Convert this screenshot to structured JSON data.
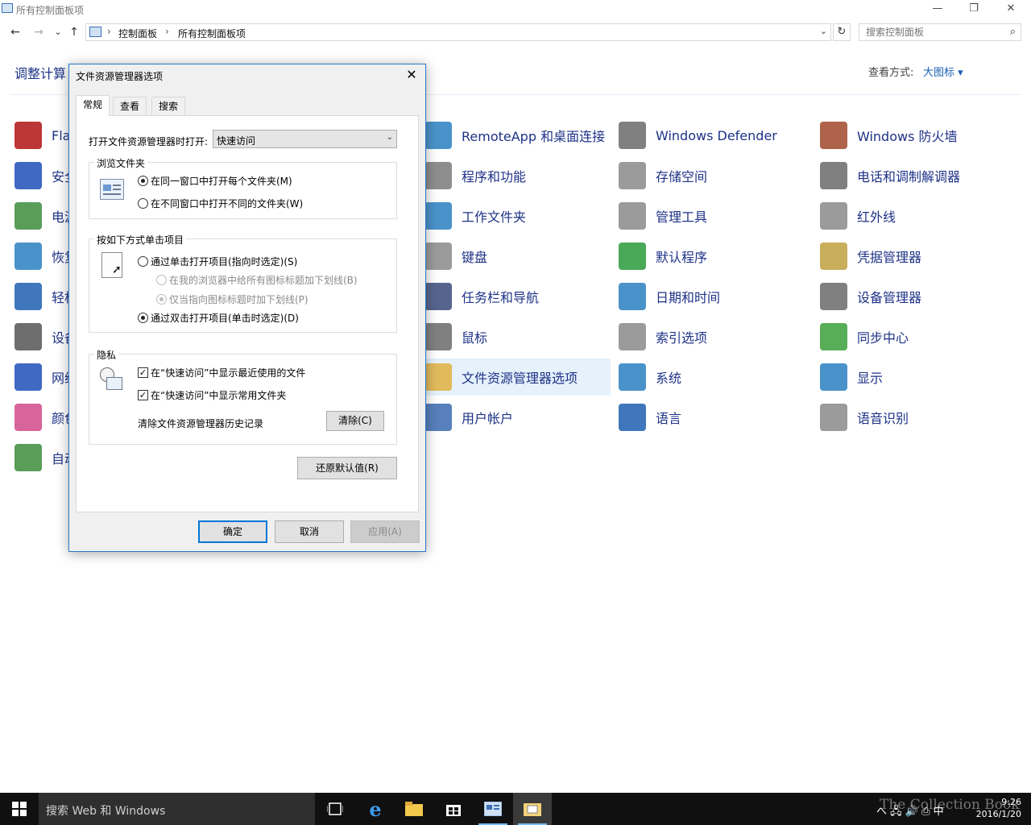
{
  "window": {
    "title": "所有控制面板项",
    "controls": {
      "minimize": "—",
      "restore": "❐",
      "close": "✕"
    }
  },
  "nav": {
    "back": "←",
    "forward": "→",
    "recent": "⌄",
    "up": "↑",
    "breadcrumb": [
      "控制面板",
      "所有控制面板项"
    ],
    "refresh": "↻",
    "search_placeholder": "搜索控制面板"
  },
  "header": {
    "title": "调整计算",
    "view_label": "查看方式:",
    "view_value": "大图标 ▾"
  },
  "items": {
    "col1": [
      {
        "label": "Fla",
        "icon": "flash-icon",
        "color": "#b01414"
      },
      {
        "label": "安全",
        "icon": "security-flag-icon",
        "color": "#1f4fb8"
      },
      {
        "label": "电源",
        "icon": "power-options-icon",
        "color": "#3c8c3c"
      },
      {
        "label": "恢复",
        "icon": "recovery-icon",
        "color": "#2a7fc1"
      },
      {
        "label": "轻松",
        "icon": "ease-of-access-icon",
        "color": "#1f5fb0"
      },
      {
        "label": "设备",
        "icon": "devices-printers-icon",
        "color": "#555555"
      },
      {
        "label": "网络",
        "icon": "network-icon",
        "color": "#1f4fb8"
      },
      {
        "label": "颜色",
        "icon": "color-management-icon",
        "color": "#d04a8a"
      },
      {
        "label": "自动",
        "icon": "autoplay-icon",
        "color": "#3c8c3c"
      }
    ],
    "col2": [
      {
        "label": "RemoteApp 和桌面连接",
        "icon": "remoteapp-icon",
        "color": "#2a7fc1"
      },
      {
        "label": "程序和功能",
        "icon": "programs-features-icon",
        "color": "#7a7a7a"
      },
      {
        "label": "工作文件夹",
        "icon": "work-folders-icon",
        "color": "#2a7fc1"
      },
      {
        "label": "键盘",
        "icon": "keyboard-icon",
        "color": "#8a8a8a"
      },
      {
        "label": "任务栏和导航",
        "icon": "taskbar-icon",
        "color": "#3a4a7a"
      },
      {
        "label": "鼠标",
        "icon": "mouse-icon",
        "color": "#6a6a6a"
      },
      {
        "label": "文件资源管理器选项",
        "icon": "file-explorer-options-icon",
        "color": "#e0b040",
        "selected": true
      },
      {
        "label": "用户帐户",
        "icon": "user-accounts-icon",
        "color": "#3a6ab0"
      }
    ],
    "col3": [
      {
        "label": "Windows Defender",
        "icon": "windows-defender-icon",
        "color": "#6a6a6a"
      },
      {
        "label": "存储空间",
        "icon": "storage-spaces-icon",
        "color": "#8a8a8a"
      },
      {
        "label": "管理工具",
        "icon": "admin-tools-icon",
        "color": "#8a8a8a"
      },
      {
        "label": "默认程序",
        "icon": "default-programs-icon",
        "color": "#2a9a3a"
      },
      {
        "label": "日期和时间",
        "icon": "date-time-icon",
        "color": "#2a7fc1"
      },
      {
        "label": "索引选项",
        "icon": "indexing-options-icon",
        "color": "#8a8a8a"
      },
      {
        "label": "系统",
        "icon": "system-icon",
        "color": "#2a7fc1"
      },
      {
        "label": "语言",
        "icon": "language-icon",
        "color": "#1f5fb0"
      }
    ],
    "col4": [
      {
        "label": "Windows 防火墙",
        "icon": "firewall-icon",
        "color": "#a0482a"
      },
      {
        "label": "电话和调制解调器",
        "icon": "phone-modem-icon",
        "color": "#6a6a6a"
      },
      {
        "label": "红外线",
        "icon": "infrared-icon",
        "color": "#8a8a8a"
      },
      {
        "label": "凭据管理器",
        "icon": "credential-manager-icon",
        "color": "#c0a040"
      },
      {
        "label": "设备管理器",
        "icon": "device-manager-icon",
        "color": "#6a6a6a"
      },
      {
        "label": "同步中心",
        "icon": "sync-center-icon",
        "color": "#3aa03a"
      },
      {
        "label": "显示",
        "icon": "display-icon",
        "color": "#2a7fc1"
      },
      {
        "label": "语音识别",
        "icon": "speech-recognition-icon",
        "color": "#8a8a8a"
      }
    ]
  },
  "dialog": {
    "title": "文件资源管理器选项",
    "close": "✕",
    "tabs": [
      "常规",
      "查看",
      "搜索"
    ],
    "open_label": "打开文件资源管理器时打开:",
    "open_value": "快速访问",
    "browse": {
      "title": "浏览文件夹",
      "option1": "在同一窗口中打开每个文件夹(M)",
      "option2": "在不同窗口中打开不同的文件夹(W)"
    },
    "click": {
      "title": "按如下方式单击项目",
      "single": "通过单击打开项目(指向时选定)(S)",
      "underline_all": "在我的浏览器中给所有图标标题加下划线(B)",
      "underline_point": "仅当指向图标标题时加下划线(P)",
      "double": "通过双击打开项目(单击时选定)(D)"
    },
    "privacy": {
      "title": "隐私",
      "recent_files": "在“快速访问”中显示最近使用的文件",
      "frequent_folders": "在“快速访问”中显示常用文件夹",
      "clear_label": "清除文件资源管理器历史记录",
      "clear_button": "清除(C)"
    },
    "restore_defaults": "还原默认值(R)",
    "ok": "确定",
    "cancel": "取消",
    "apply": "应用(A)"
  },
  "taskbar": {
    "search_text": "搜索 Web 和 Windows",
    "tray_text": "へ 🖧 🔊 ⎙ 中",
    "time": "9:26",
    "date": "2016/1/20"
  },
  "watermark": "The Collection Book"
}
